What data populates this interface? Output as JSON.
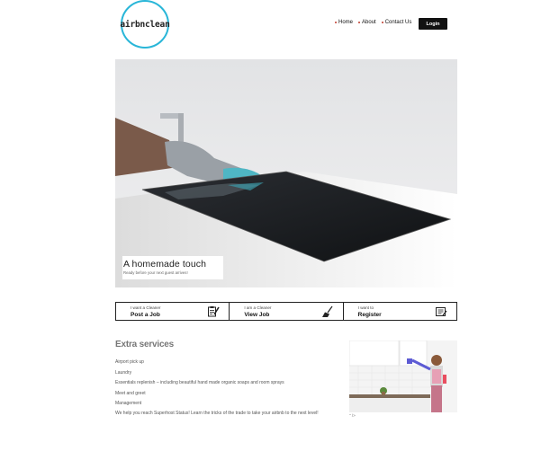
{
  "header": {
    "logo_text": "airbnclean",
    "nav": [
      {
        "label": "Home"
      },
      {
        "label": "About"
      },
      {
        "label": "Contact Us"
      }
    ],
    "login_label": "Login"
  },
  "hero": {
    "title": "A homemade touch",
    "subtitle": "Ready before your next guest arrives!"
  },
  "actions": [
    {
      "small": "I want a Cleaner",
      "big": "Post a Job",
      "icon": "clipboard-pencil-icon"
    },
    {
      "small": "I am a Cleaner",
      "big": "View Job",
      "icon": "broom-icon"
    },
    {
      "small": "I want to",
      "big": "Register",
      "icon": "register-form-icon"
    }
  ],
  "extra": {
    "title": "Extra services",
    "items": [
      "Airport pick up",
      "Laundry",
      "Essentials replenish – including beautiful hand made organic soaps and room sprays",
      "Meet and greet",
      "Management"
    ],
    "note": "We help you reach Superhost Status! Learn the tricks of the trade to take your airbnb to the next level!",
    "image_caption": "\" />"
  },
  "colors": {
    "accent": "#29b6d8",
    "dark": "#111111",
    "nav_dot": "#c0392b"
  }
}
